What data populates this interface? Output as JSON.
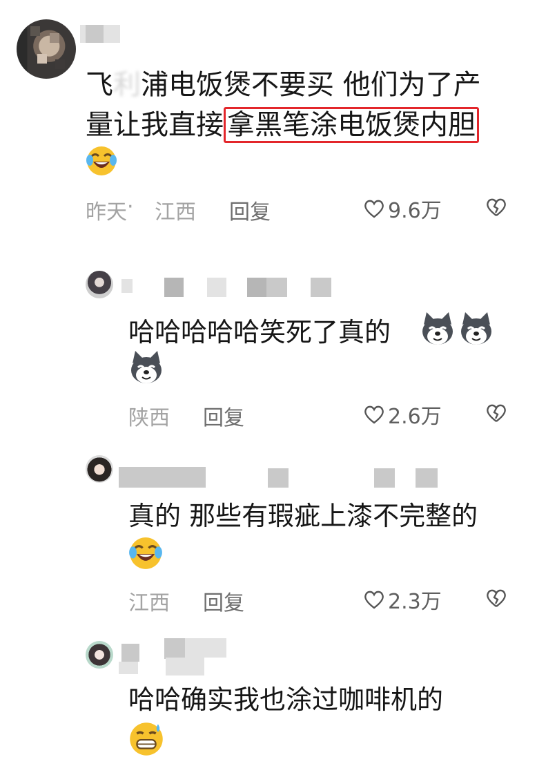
{
  "comments": [
    {
      "text_before": "飞",
      "text_hidden": "利",
      "text_after": "浦电饭煲不要买 他们为了产量让我直接",
      "text_highlight": "拿黑笔涂电饭煲内胆",
      "emoji": "laughing-tears-icon",
      "time": "昨天",
      "location_sep": " · ",
      "location": "江西",
      "reply_label": "回复",
      "likes": "9.6万"
    }
  ],
  "replies": [
    {
      "text": "哈哈哈哈哈笑死了真的",
      "emoji": "husky-dog-icon",
      "location": "陕西",
      "reply_label": "回复",
      "likes": "2.6万"
    },
    {
      "text": "真的 那些有瑕疵上漆不完整的",
      "emoji": "laughing-tears-icon",
      "location": "江西",
      "reply_label": "回复",
      "likes": "2.3万"
    },
    {
      "text": "哈哈确实我也涂过咖啡机的",
      "emoji": "grinning-sweat-icon"
    }
  ],
  "colors": {
    "highlight_border": "#e3262b",
    "meta_text": "#a3a3a3",
    "body_text": "#161616",
    "emoji_yellow": "#f7c22d"
  }
}
